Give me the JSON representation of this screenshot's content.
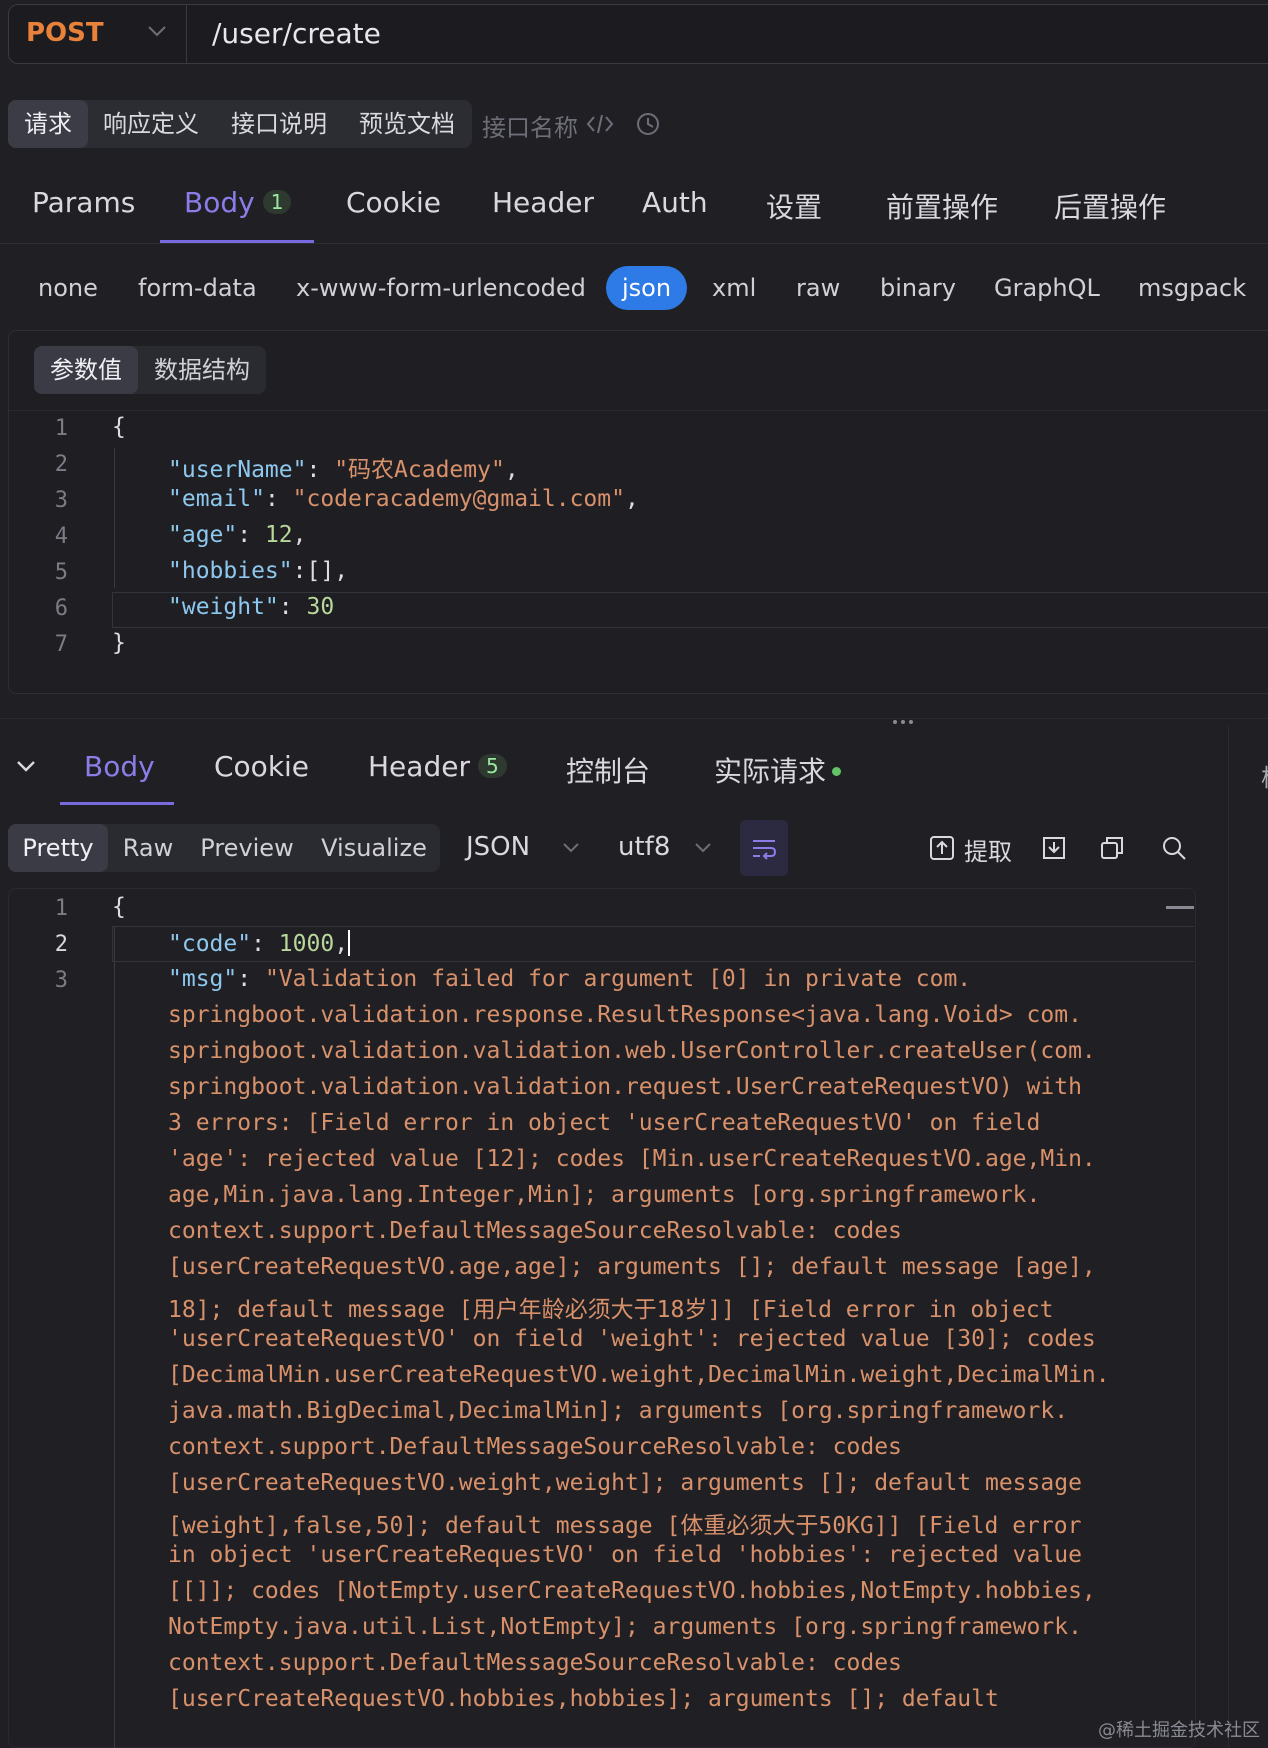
{
  "url_bar": {
    "method": "POST",
    "path": "/user/create"
  },
  "top_tabs": [
    "请求",
    "响应定义",
    "接口说明",
    "预览文档"
  ],
  "api_name_placeholder": "接口名称",
  "request_tabs": [
    {
      "label": "Params"
    },
    {
      "label": "Body",
      "badge": "1"
    },
    {
      "label": "Cookie"
    },
    {
      "label": "Header"
    },
    {
      "label": "Auth"
    },
    {
      "label": "设置"
    },
    {
      "label": "前置操作"
    },
    {
      "label": "后置操作"
    }
  ],
  "body_types": [
    "none",
    "form-data",
    "x-www-form-urlencoded",
    "json",
    "xml",
    "raw",
    "binary",
    "GraphQL",
    "msgpack"
  ],
  "body_type_selected": "json",
  "editor_segments": [
    "参数值",
    "数据结构"
  ],
  "request_line_numbers": [
    "1",
    "2",
    "3",
    "4",
    "5",
    "6",
    "7"
  ],
  "request_body": {
    "open": "{",
    "lines": [
      {
        "key": "\"userName\"",
        "sep": ": ",
        "value": "\"码农Academy\"",
        "value_type": "string",
        "tail": ","
      },
      {
        "key": "\"email\"",
        "sep": ": ",
        "value": "\"coderacademy@gmail.com\"",
        "value_type": "string",
        "tail": ","
      },
      {
        "key": "\"age\"",
        "sep": ": ",
        "value": "12",
        "value_type": "number",
        "tail": ","
      },
      {
        "key": "\"hobbies\"",
        "sep": ":",
        "value": "[]",
        "value_type": "plain",
        "tail": ","
      },
      {
        "key": "\"weight\"",
        "sep": ": ",
        "value": "30",
        "value_type": "number",
        "tail": ""
      }
    ],
    "close": "}"
  },
  "response_tabs": [
    {
      "label": "Body"
    },
    {
      "label": "Cookie"
    },
    {
      "label": "Header",
      "badge": "5"
    },
    {
      "label": "控制台"
    },
    {
      "label": "实际请求"
    }
  ],
  "view_modes": [
    "Pretty",
    "Raw",
    "Preview",
    "Visualize"
  ],
  "format_select": "JSON",
  "encoding_select": "utf8",
  "extract_label": "提取",
  "right_panel_stub": "核",
  "response_line_numbers": [
    "1",
    "2",
    "3"
  ],
  "response_body": {
    "open": "{",
    "code_key": "\"code\"",
    "code_value": "1000",
    "msg_key": "\"msg\"",
    "msg_lines": [
      "\"Validation failed for argument [0] in private com.",
      "springboot.validation.response.ResultResponse<java.lang.Void> com.",
      "springboot.validation.validation.web.UserController.createUser(com.",
      "springboot.validation.validation.request.UserCreateRequestVO) with",
      "3 errors: [Field error in object 'userCreateRequestVO' on field",
      "'age': rejected value [12]; codes [Min.userCreateRequestVO.age,Min.",
      "age,Min.java.lang.Integer,Min]; arguments [org.springframework.",
      "context.support.DefaultMessageSourceResolvable: codes",
      "[userCreateRequestVO.age,age]; arguments []; default message [age],",
      "18]; default message [用户年龄必须大于18岁]] [Field error in object",
      "'userCreateRequestVO' on field 'weight': rejected value [30]; codes",
      "[DecimalMin.userCreateRequestVO.weight,DecimalMin.weight,DecimalMin.",
      "java.math.BigDecimal,DecimalMin]; arguments [org.springframework.",
      "context.support.DefaultMessageSourceResolvable: codes",
      "[userCreateRequestVO.weight,weight]; arguments []; default message",
      "[weight],false,50]; default message [体重必须大于50KG]] [Field error",
      "in object 'userCreateRequestVO' on field 'hobbies': rejected value",
      "[[]]; codes [NotEmpty.userCreateRequestVO.hobbies,NotEmpty.hobbies,",
      "NotEmpty.java.util.List,NotEmpty]; arguments [org.springframework.",
      "context.support.DefaultMessageSourceResolvable: codes",
      "[userCreateRequestVO.hobbies,hobbies]; arguments []; default"
    ]
  },
  "watermark": "@稀土掘金技术社区",
  "colors": {
    "accent": "#7a6ae0",
    "method": "#e8823a",
    "json_selected": "#2e7ae6",
    "key": "#8fc8ef",
    "string": "#d8916a",
    "number": "#b7d89a"
  },
  "icons": [
    "chevron-down-icon",
    "code-icon",
    "history-icon",
    "collapse-icon",
    "wrap-icon",
    "extract-icon",
    "download-icon",
    "copy-icon",
    "search-icon"
  ]
}
